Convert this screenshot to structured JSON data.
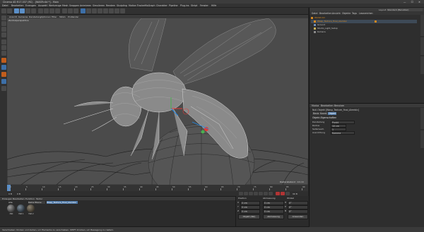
{
  "window": {
    "title": "Cinema 4D R17.037 (RC) - [WASP.c4d *] - Main"
  },
  "menubar": [
    "Datei",
    "Bearbeiten",
    "Erzeugen",
    "Auswahl",
    "Werkzeuge",
    "Mesh",
    "Snappen",
    "Animieren",
    "Simulieren",
    "Rendern",
    "Skulpting",
    "Motion Tracker",
    "MoGraph",
    "Charakter",
    "Pipeline",
    "Plug-ins",
    "Skript",
    "Fenster",
    "Hilfe"
  ],
  "layout": {
    "label": "Layout:",
    "value": "Standard (Benutzer)"
  },
  "viewport": {
    "menu": [
      "Ansicht",
      "Kameras",
      "Darstellung",
      "Optionen",
      "Filter",
      "Tafeln",
      "ProRender"
    ],
    "label": "Zentralperspektive",
    "grid_spacing": "Rasterabstand : 10 cm"
  },
  "timeline": {
    "ticks": [
      "0",
      "5",
      "10",
      "15",
      "20",
      "25",
      "30",
      "35",
      "40",
      "45",
      "50",
      "55",
      "60",
      "65",
      "70",
      "75",
      "80",
      "85",
      "90"
    ]
  },
  "transport": {
    "frame_start": "0 B",
    "frame_current": "0 B",
    "frame_end": "90 B"
  },
  "materials": {
    "tabs": [
      "Erzeugen",
      "Bearbeiten",
      "Funktion",
      "Textur"
    ],
    "filter": [
      "Alle",
      "Keine Ebene",
      "Wasp_Texture_final_Alembic"
    ],
    "balls": [
      "Mat",
      "Mat.1",
      "Mat.2"
    ]
  },
  "coordinates": {
    "headers": [
      "Position",
      "Abmessung",
      "Winkel"
    ],
    "rows": [
      {
        "axis": "X",
        "pos": "0 cm",
        "size": "0 cm",
        "angle_label": "H",
        "angle": "0°"
      },
      {
        "axis": "Y",
        "pos": "0 cm",
        "size": "0 cm",
        "angle_label": "P",
        "angle": "0°"
      },
      {
        "axis": "Z",
        "pos": "0 cm",
        "size": "0 cm",
        "angle_label": "B",
        "angle": "0°"
      }
    ],
    "mode": "Objekt (Rel)",
    "mode2": "Abmessung",
    "apply": "Anwenden"
  },
  "status": {
    "text": "Verschieben: Klicken und ziehen, um Elemente zu verschieben. SHIFT drücken, um Bewegung zu rastern."
  },
  "object_manager": {
    "tabs": [
      "Datei",
      "Bearbeiten",
      "Ansicht",
      "Objekte",
      "Tags",
      "Lesezeichen"
    ],
    "items": [
      {
        "name": "WASP.c4d",
        "color": "#d9891f",
        "indent": 0,
        "selected": false
      },
      {
        "name": "Wasp_Texture_final_Alembic",
        "color": "#d9891f",
        "indent": 1,
        "selected": true
      },
      {
        "name": "Ground",
        "color": "#c8c8c8",
        "indent": 1,
        "selected": false
      },
      {
        "name": "Studio_Light_Setup",
        "color": "#c8c8c8",
        "indent": 1,
        "selected": false
      },
      {
        "name": "Kamera",
        "color": "#c8c8c8",
        "indent": 1,
        "selected": false
      }
    ]
  },
  "attributes": {
    "tabs": [
      "Modus",
      "Bearbeiten",
      "Benutzer"
    ],
    "object_line": "Null-Objekt [Wasp_Texture_final_Alembic]",
    "subtabs": [
      "Basis",
      "Koord.",
      "Objekt"
    ],
    "section": "Objekt-Eigenschaften",
    "fields": [
      {
        "label": "Darstellung",
        "value": "Punkt"
      },
      {
        "label": "Radius",
        "value": "10 cm"
      },
      {
        "label": "Seitenverh.",
        "value": "1"
      },
      {
        "label": "Ausrichtung",
        "value": "Kamera"
      }
    ]
  },
  "accent": "#5b8fc8",
  "selection_color": "#d9891f"
}
